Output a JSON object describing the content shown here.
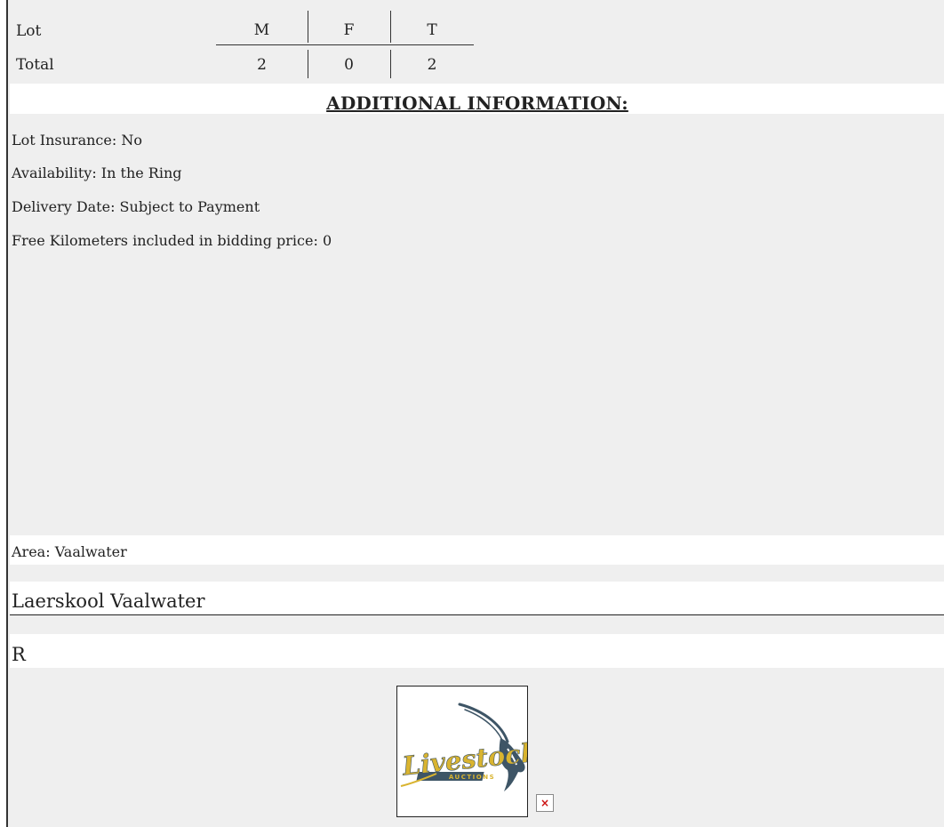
{
  "stock_table": {
    "row_labels": {
      "lot": "Lot",
      "total": "Total"
    },
    "columns": [
      "M",
      "F",
      "T"
    ],
    "totals": [
      "2",
      "0",
      "2"
    ]
  },
  "additional": {
    "heading": "ADDITIONAL INFORMATION:",
    "lines": [
      "Lot Insurance: No",
      "Availability: In the Ring",
      "Delivery Date: Subject to Payment",
      "Free Kilometers included in bidding price: 0"
    ]
  },
  "area": "Area: Vaalwater",
  "location": "Laerskool Vaalwater",
  "price": "R",
  "logo": {
    "icon": "livestock-auctions-logo",
    "script_text": "Livestock",
    "banner_text": "AUCTIONS"
  },
  "broken_image": {
    "icon": "broken-image-icon",
    "glyph": "×"
  },
  "colors": {
    "panel_background": "#efefef",
    "band_background": "#ffffff",
    "logo_gold": "#d9b430",
    "logo_slate": "#3e5566"
  }
}
